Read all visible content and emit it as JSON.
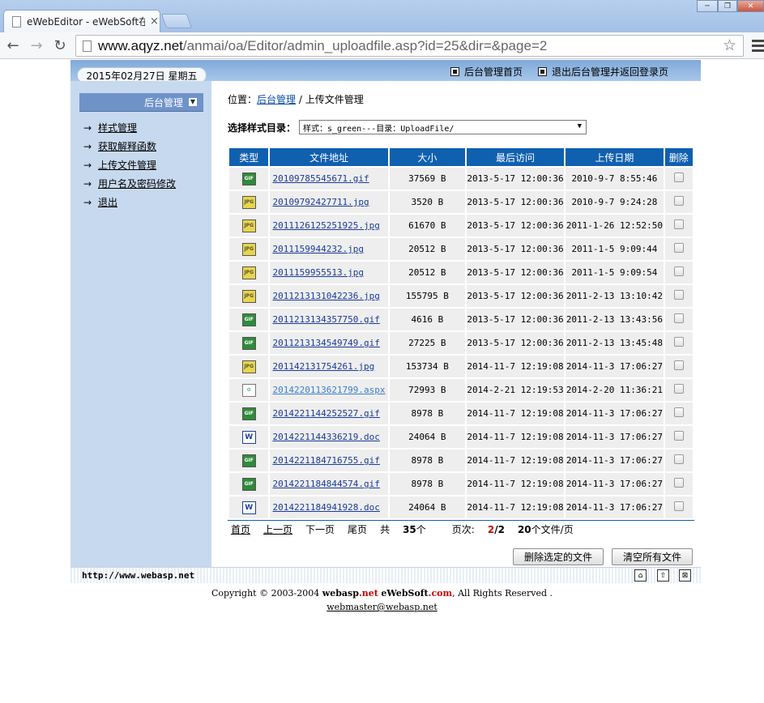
{
  "browser": {
    "tab_title": "eWebEditor - eWebSoft在线",
    "tab_close": "×",
    "url_host": "www.aqyz.net",
    "url_path": "/anmai/oa/Editor/admin_uploadfile.asp?id=25&dir=&page=2",
    "win_minimize": "─",
    "win_restore": "❐",
    "win_close": "✕"
  },
  "header": {
    "date": "2015年02月27日 星期五",
    "links": [
      "后台管理首页",
      "退出后台管理并返回登录页"
    ]
  },
  "sidebar": {
    "title": "后台管理",
    "items": [
      "样式管理",
      "获取解释函数",
      "上传文件管理",
      "用户名及密码修改",
      "退出"
    ]
  },
  "breadcrumb": {
    "prefix": "位置：",
    "link": "后台管理",
    "sep": " / ",
    "current": "上传文件管理"
  },
  "selector": {
    "label": "选择样式目录：",
    "value": "样式：s_green---目录：UploadFile/"
  },
  "table": {
    "headers": [
      "类型",
      "文件地址",
      "大小",
      "最后访问",
      "上传日期",
      "删除"
    ],
    "rows": [
      {
        "type": "gif",
        "icon": "GIF",
        "name": "20109785545671.gif",
        "size": "37569 B",
        "accessed": "2013-5-17 12:00:36",
        "uploaded": "2010-9-7 8:55:46"
      },
      {
        "type": "jpg",
        "icon": "JPG",
        "name": "20109792427711.jpg",
        "size": "3520 B",
        "accessed": "2013-5-17 12:00:36",
        "uploaded": "2010-9-7 9:24:28"
      },
      {
        "type": "jpg",
        "icon": "JPG",
        "name": "2011126125251925.jpg",
        "size": "61670 B",
        "accessed": "2013-5-17 12:00:36",
        "uploaded": "2011-1-26 12:52:50"
      },
      {
        "type": "jpg",
        "icon": "JPG",
        "name": "2011159944232.jpg",
        "size": "20512 B",
        "accessed": "2013-5-17 12:00:36",
        "uploaded": "2011-1-5 9:09:44"
      },
      {
        "type": "jpg",
        "icon": "JPG",
        "name": "2011159955513.jpg",
        "size": "20512 B",
        "accessed": "2013-5-17 12:00:36",
        "uploaded": "2011-1-5 9:09:54"
      },
      {
        "type": "jpg",
        "icon": "JPG",
        "name": "2011213131042236.jpg",
        "size": "155795 B",
        "accessed": "2013-5-17 12:00:36",
        "uploaded": "2011-2-13 13:10:42"
      },
      {
        "type": "gif",
        "icon": "GIF",
        "name": "2011213134357750.gif",
        "size": "4616 B",
        "accessed": "2013-5-17 12:00:36",
        "uploaded": "2011-2-13 13:43:56"
      },
      {
        "type": "gif",
        "icon": "GIF",
        "name": "2011213134549749.gif",
        "size": "27225 B",
        "accessed": "2013-5-17 12:00:36",
        "uploaded": "2011-2-13 13:45:48"
      },
      {
        "type": "jpg",
        "icon": "JPG",
        "name": "201142131754261.jpg",
        "size": "153734 B",
        "accessed": "2014-11-7 12:19:08",
        "uploaded": "2014-11-3 17:06:27"
      },
      {
        "type": "aspx",
        "icon": "⚙",
        "name": "2014220113621799.aspx",
        "size": "72993 B",
        "accessed": "2014-2-21 12:19:53",
        "uploaded": "2014-2-20 11:36:21",
        "visited": true
      },
      {
        "type": "gif",
        "icon": "GIF",
        "name": "2014221144252527.gif",
        "size": "8978 B",
        "accessed": "2014-11-7 12:19:08",
        "uploaded": "2014-11-3 17:06:27"
      },
      {
        "type": "doc",
        "icon": "W",
        "name": "2014221144336219.doc",
        "size": "24064 B",
        "accessed": "2014-11-7 12:19:08",
        "uploaded": "2014-11-3 17:06:27"
      },
      {
        "type": "gif",
        "icon": "GIF",
        "name": "2014221184716755.gif",
        "size": "8978 B",
        "accessed": "2014-11-7 12:19:08",
        "uploaded": "2014-11-3 17:06:27"
      },
      {
        "type": "gif",
        "icon": "GIF",
        "name": "2014221184844574.gif",
        "size": "8978 B",
        "accessed": "2014-11-7 12:19:08",
        "uploaded": "2014-11-3 17:06:27"
      },
      {
        "type": "doc",
        "icon": "W",
        "name": "2014221184941928.doc",
        "size": "24064 B",
        "accessed": "2014-11-7 12:19:08",
        "uploaded": "2014-11-3 17:06:27"
      }
    ]
  },
  "pager": {
    "first": "首页",
    "prev": "上一页",
    "next": "下一页",
    "last": "尾页",
    "total_prefix": "共",
    "total": "35",
    "total_suffix": "个",
    "page_prefix": "页次:",
    "page_current": "2",
    "page_sep": "/",
    "page_total": "2",
    "per_page": "20",
    "per_page_suffix": "个文件/页"
  },
  "buttons": {
    "delete_selected": "删除选定的文件",
    "clear_all": "清空所有文件"
  },
  "statusbar": {
    "site": "http://www.webasp.net"
  },
  "footer": {
    "copyright_prefix": "Copyright © 2003-2004 ",
    "brand1_a": "webasp",
    "brand1_b": ".net",
    "brand2_a": "eWebSoft",
    "brand2_b": ".com",
    "copyright_suffix": ", All Rights Reserved .",
    "email": "webmaster@webasp.net"
  },
  "colors": {
    "header_blue": "#1060b0",
    "sidebar_bg": "#c7d9ee",
    "accent_red": "#cc0000"
  }
}
